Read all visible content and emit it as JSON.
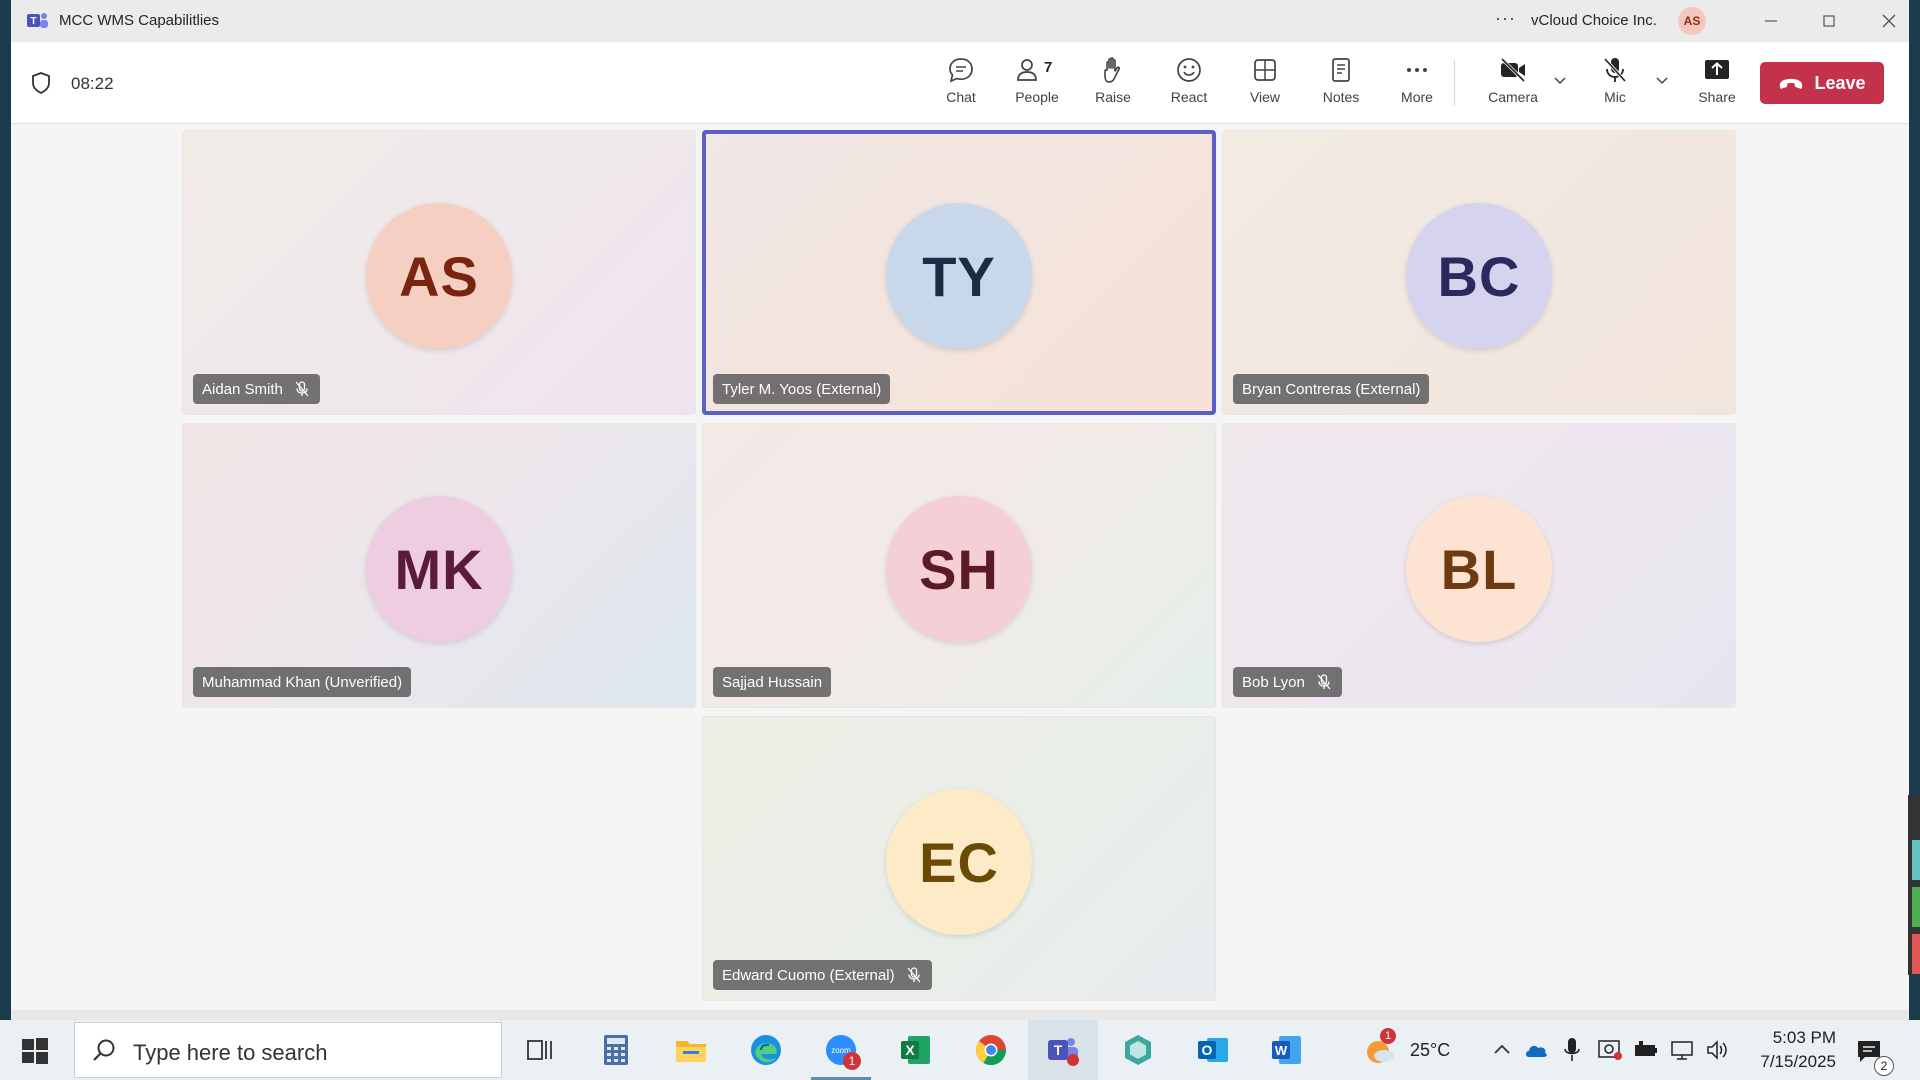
{
  "window": {
    "title": "MCC WMS Capabilitlies",
    "more_label": "···",
    "org_name": "vCloud Choice Inc.",
    "user_initials": "AS"
  },
  "toolbar": {
    "timer": "08:22",
    "chat_label": "Chat",
    "people_label": "People",
    "people_count": "7",
    "raise_label": "Raise",
    "react_label": "React",
    "view_label": "View",
    "notes_label": "Notes",
    "more_label": "More",
    "camera_label": "Camera",
    "mic_label": "Mic",
    "share_label": "Share",
    "leave_label": "Leave"
  },
  "participants": [
    {
      "initials": "AS",
      "name": "Aidan Smith",
      "muted": true,
      "circle_bg": "#f6cfc3",
      "circle_fg": "#7a2410"
    },
    {
      "initials": "TY",
      "name": "Tyler M. Yoos (External)",
      "muted": false,
      "circle_bg": "#c9d7ea",
      "circle_fg": "#1d2b45",
      "active": true
    },
    {
      "initials": "BC",
      "name": "Bryan Contreras (External)",
      "muted": false,
      "circle_bg": "#d6d3ee",
      "circle_fg": "#2b2a5c"
    },
    {
      "initials": "MK",
      "name": "Muhammad Khan (Unverified)",
      "muted": false,
      "circle_bg": "#efcde0",
      "circle_fg": "#5a1a3c"
    },
    {
      "initials": "SH",
      "name": "Sajjad Hussain",
      "muted": false,
      "circle_bg": "#f4cfd5",
      "circle_fg": "#5c1a24"
    },
    {
      "initials": "BL",
      "name": "Bob Lyon",
      "muted": true,
      "circle_bg": "#fde4d2",
      "circle_fg": "#6e3a12"
    },
    {
      "initials": "EC",
      "name": "Edward Cuomo (External)",
      "muted": true,
      "circle_bg": "#fcebc6",
      "circle_fg": "#6b4a06"
    }
  ],
  "taskbar": {
    "search_placeholder": "Type here to search",
    "weather_temp": "25°C",
    "weather_badge": "1",
    "zoom_badge": "1",
    "time": "5:03 PM",
    "date": "7/15/2025",
    "notification_count": "2"
  }
}
